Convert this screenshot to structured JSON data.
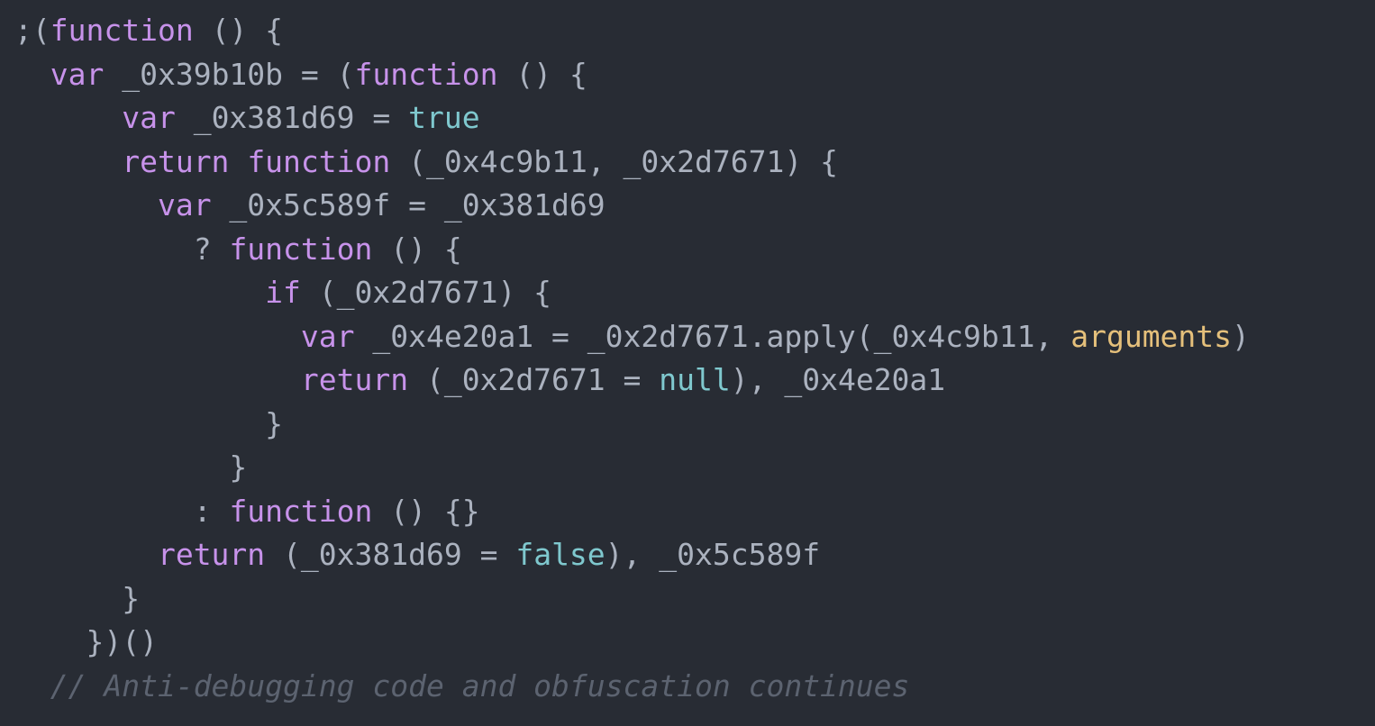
{
  "editor": {
    "background_color": "#282c34",
    "font_size_px": 33,
    "line_height_px": 48.5,
    "indent_unit_spaces": 2,
    "language": "javascript"
  },
  "theme": {
    "name": "one-dark",
    "background": "#282c34",
    "foreground": "#abb2bf",
    "keyword": "#c792ea",
    "literal": "#7fc8ce",
    "builtin": "#e5c07b",
    "comment": "#5c6370"
  },
  "code": {
    "lines": [
      {
        "indent": 0,
        "tokens": [
          {
            "text": ";(",
            "type": "plain"
          },
          {
            "text": "function",
            "type": "kw"
          },
          {
            "text": " () {",
            "type": "plain"
          }
        ]
      },
      {
        "indent": 2,
        "tokens": [
          {
            "text": "var",
            "type": "kw"
          },
          {
            "text": " _0x39b10b = (",
            "type": "plain"
          },
          {
            "text": "function",
            "type": "kw"
          },
          {
            "text": " () {",
            "type": "plain"
          }
        ]
      },
      {
        "indent": 6,
        "tokens": [
          {
            "text": "var",
            "type": "kw"
          },
          {
            "text": " _0x381d69 = ",
            "type": "plain"
          },
          {
            "text": "true",
            "type": "literal"
          }
        ]
      },
      {
        "indent": 6,
        "tokens": [
          {
            "text": "return",
            "type": "kw"
          },
          {
            "text": " ",
            "type": "plain"
          },
          {
            "text": "function",
            "type": "kw"
          },
          {
            "text": " (_0x4c9b11, _0x2d7671) {",
            "type": "plain"
          }
        ]
      },
      {
        "indent": 8,
        "tokens": [
          {
            "text": "var",
            "type": "kw"
          },
          {
            "text": " _0x5c589f = _0x381d69",
            "type": "plain"
          }
        ]
      },
      {
        "indent": 10,
        "tokens": [
          {
            "text": "? ",
            "type": "plain"
          },
          {
            "text": "function",
            "type": "kw"
          },
          {
            "text": " () {",
            "type": "plain"
          }
        ]
      },
      {
        "indent": 14,
        "tokens": [
          {
            "text": "if",
            "type": "kw"
          },
          {
            "text": " (_0x2d7671) {",
            "type": "plain"
          }
        ]
      },
      {
        "indent": 16,
        "tokens": [
          {
            "text": "var",
            "type": "kw"
          },
          {
            "text": " _0x4e20a1 = _0x2d7671.apply(_0x4c9b11, ",
            "type": "plain"
          },
          {
            "text": "arguments",
            "type": "builtin"
          },
          {
            "text": ")",
            "type": "plain"
          }
        ]
      },
      {
        "indent": 16,
        "tokens": [
          {
            "text": "return",
            "type": "kw"
          },
          {
            "text": " (_0x2d7671 = ",
            "type": "plain"
          },
          {
            "text": "null",
            "type": "literal"
          },
          {
            "text": "), _0x4e20a1",
            "type": "plain"
          }
        ]
      },
      {
        "indent": 14,
        "tokens": [
          {
            "text": "}",
            "type": "plain"
          }
        ]
      },
      {
        "indent": 12,
        "tokens": [
          {
            "text": "}",
            "type": "plain"
          }
        ]
      },
      {
        "indent": 10,
        "tokens": [
          {
            "text": ": ",
            "type": "plain"
          },
          {
            "text": "function",
            "type": "kw"
          },
          {
            "text": " () {}",
            "type": "plain"
          }
        ]
      },
      {
        "indent": 8,
        "tokens": [
          {
            "text": "return",
            "type": "kw"
          },
          {
            "text": " (_0x381d69 = ",
            "type": "plain"
          },
          {
            "text": "false",
            "type": "literal"
          },
          {
            "text": "), _0x5c589f",
            "type": "plain"
          }
        ]
      },
      {
        "indent": 6,
        "tokens": [
          {
            "text": "}",
            "type": "plain"
          }
        ]
      },
      {
        "indent": 4,
        "tokens": [
          {
            "text": "})()",
            "type": "plain"
          }
        ]
      },
      {
        "indent": 2,
        "tokens": [
          {
            "text": "// Anti-debugging code and obfuscation continues",
            "type": "comment"
          }
        ]
      }
    ]
  }
}
